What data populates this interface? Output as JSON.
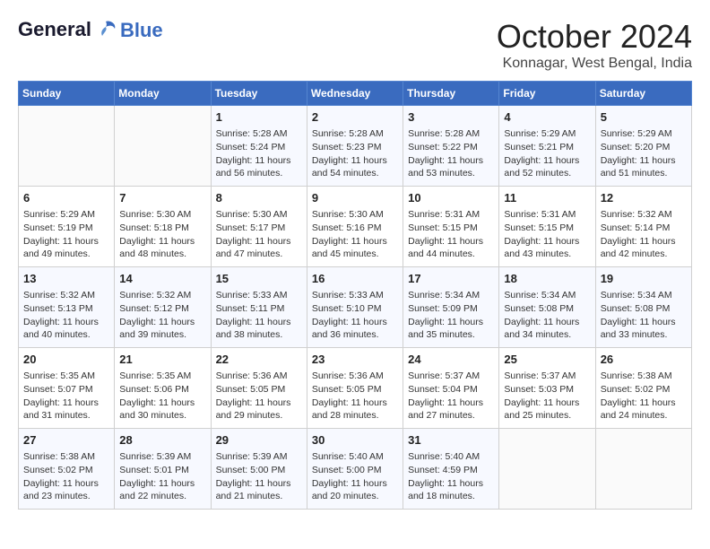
{
  "header": {
    "logo_line1": "General",
    "logo_line2": "Blue",
    "month_title": "October 2024",
    "location": "Konnagar, West Bengal, India"
  },
  "weekdays": [
    "Sunday",
    "Monday",
    "Tuesday",
    "Wednesday",
    "Thursday",
    "Friday",
    "Saturday"
  ],
  "weeks": [
    [
      {
        "day": "",
        "content": ""
      },
      {
        "day": "",
        "content": ""
      },
      {
        "day": "1",
        "content": "Sunrise: 5:28 AM\nSunset: 5:24 PM\nDaylight: 11 hours and 56 minutes."
      },
      {
        "day": "2",
        "content": "Sunrise: 5:28 AM\nSunset: 5:23 PM\nDaylight: 11 hours and 54 minutes."
      },
      {
        "day": "3",
        "content": "Sunrise: 5:28 AM\nSunset: 5:22 PM\nDaylight: 11 hours and 53 minutes."
      },
      {
        "day": "4",
        "content": "Sunrise: 5:29 AM\nSunset: 5:21 PM\nDaylight: 11 hours and 52 minutes."
      },
      {
        "day": "5",
        "content": "Sunrise: 5:29 AM\nSunset: 5:20 PM\nDaylight: 11 hours and 51 minutes."
      }
    ],
    [
      {
        "day": "6",
        "content": "Sunrise: 5:29 AM\nSunset: 5:19 PM\nDaylight: 11 hours and 49 minutes."
      },
      {
        "day": "7",
        "content": "Sunrise: 5:30 AM\nSunset: 5:18 PM\nDaylight: 11 hours and 48 minutes."
      },
      {
        "day": "8",
        "content": "Sunrise: 5:30 AM\nSunset: 5:17 PM\nDaylight: 11 hours and 47 minutes."
      },
      {
        "day": "9",
        "content": "Sunrise: 5:30 AM\nSunset: 5:16 PM\nDaylight: 11 hours and 45 minutes."
      },
      {
        "day": "10",
        "content": "Sunrise: 5:31 AM\nSunset: 5:15 PM\nDaylight: 11 hours and 44 minutes."
      },
      {
        "day": "11",
        "content": "Sunrise: 5:31 AM\nSunset: 5:15 PM\nDaylight: 11 hours and 43 minutes."
      },
      {
        "day": "12",
        "content": "Sunrise: 5:32 AM\nSunset: 5:14 PM\nDaylight: 11 hours and 42 minutes."
      }
    ],
    [
      {
        "day": "13",
        "content": "Sunrise: 5:32 AM\nSunset: 5:13 PM\nDaylight: 11 hours and 40 minutes."
      },
      {
        "day": "14",
        "content": "Sunrise: 5:32 AM\nSunset: 5:12 PM\nDaylight: 11 hours and 39 minutes."
      },
      {
        "day": "15",
        "content": "Sunrise: 5:33 AM\nSunset: 5:11 PM\nDaylight: 11 hours and 38 minutes."
      },
      {
        "day": "16",
        "content": "Sunrise: 5:33 AM\nSunset: 5:10 PM\nDaylight: 11 hours and 36 minutes."
      },
      {
        "day": "17",
        "content": "Sunrise: 5:34 AM\nSunset: 5:09 PM\nDaylight: 11 hours and 35 minutes."
      },
      {
        "day": "18",
        "content": "Sunrise: 5:34 AM\nSunset: 5:08 PM\nDaylight: 11 hours and 34 minutes."
      },
      {
        "day": "19",
        "content": "Sunrise: 5:34 AM\nSunset: 5:08 PM\nDaylight: 11 hours and 33 minutes."
      }
    ],
    [
      {
        "day": "20",
        "content": "Sunrise: 5:35 AM\nSunset: 5:07 PM\nDaylight: 11 hours and 31 minutes."
      },
      {
        "day": "21",
        "content": "Sunrise: 5:35 AM\nSunset: 5:06 PM\nDaylight: 11 hours and 30 minutes."
      },
      {
        "day": "22",
        "content": "Sunrise: 5:36 AM\nSunset: 5:05 PM\nDaylight: 11 hours and 29 minutes."
      },
      {
        "day": "23",
        "content": "Sunrise: 5:36 AM\nSunset: 5:05 PM\nDaylight: 11 hours and 28 minutes."
      },
      {
        "day": "24",
        "content": "Sunrise: 5:37 AM\nSunset: 5:04 PM\nDaylight: 11 hours and 27 minutes."
      },
      {
        "day": "25",
        "content": "Sunrise: 5:37 AM\nSunset: 5:03 PM\nDaylight: 11 hours and 25 minutes."
      },
      {
        "day": "26",
        "content": "Sunrise: 5:38 AM\nSunset: 5:02 PM\nDaylight: 11 hours and 24 minutes."
      }
    ],
    [
      {
        "day": "27",
        "content": "Sunrise: 5:38 AM\nSunset: 5:02 PM\nDaylight: 11 hours and 23 minutes."
      },
      {
        "day": "28",
        "content": "Sunrise: 5:39 AM\nSunset: 5:01 PM\nDaylight: 11 hours and 22 minutes."
      },
      {
        "day": "29",
        "content": "Sunrise: 5:39 AM\nSunset: 5:00 PM\nDaylight: 11 hours and 21 minutes."
      },
      {
        "day": "30",
        "content": "Sunrise: 5:40 AM\nSunset: 5:00 PM\nDaylight: 11 hours and 20 minutes."
      },
      {
        "day": "31",
        "content": "Sunrise: 5:40 AM\nSunset: 4:59 PM\nDaylight: 11 hours and 18 minutes."
      },
      {
        "day": "",
        "content": ""
      },
      {
        "day": "",
        "content": ""
      }
    ]
  ]
}
